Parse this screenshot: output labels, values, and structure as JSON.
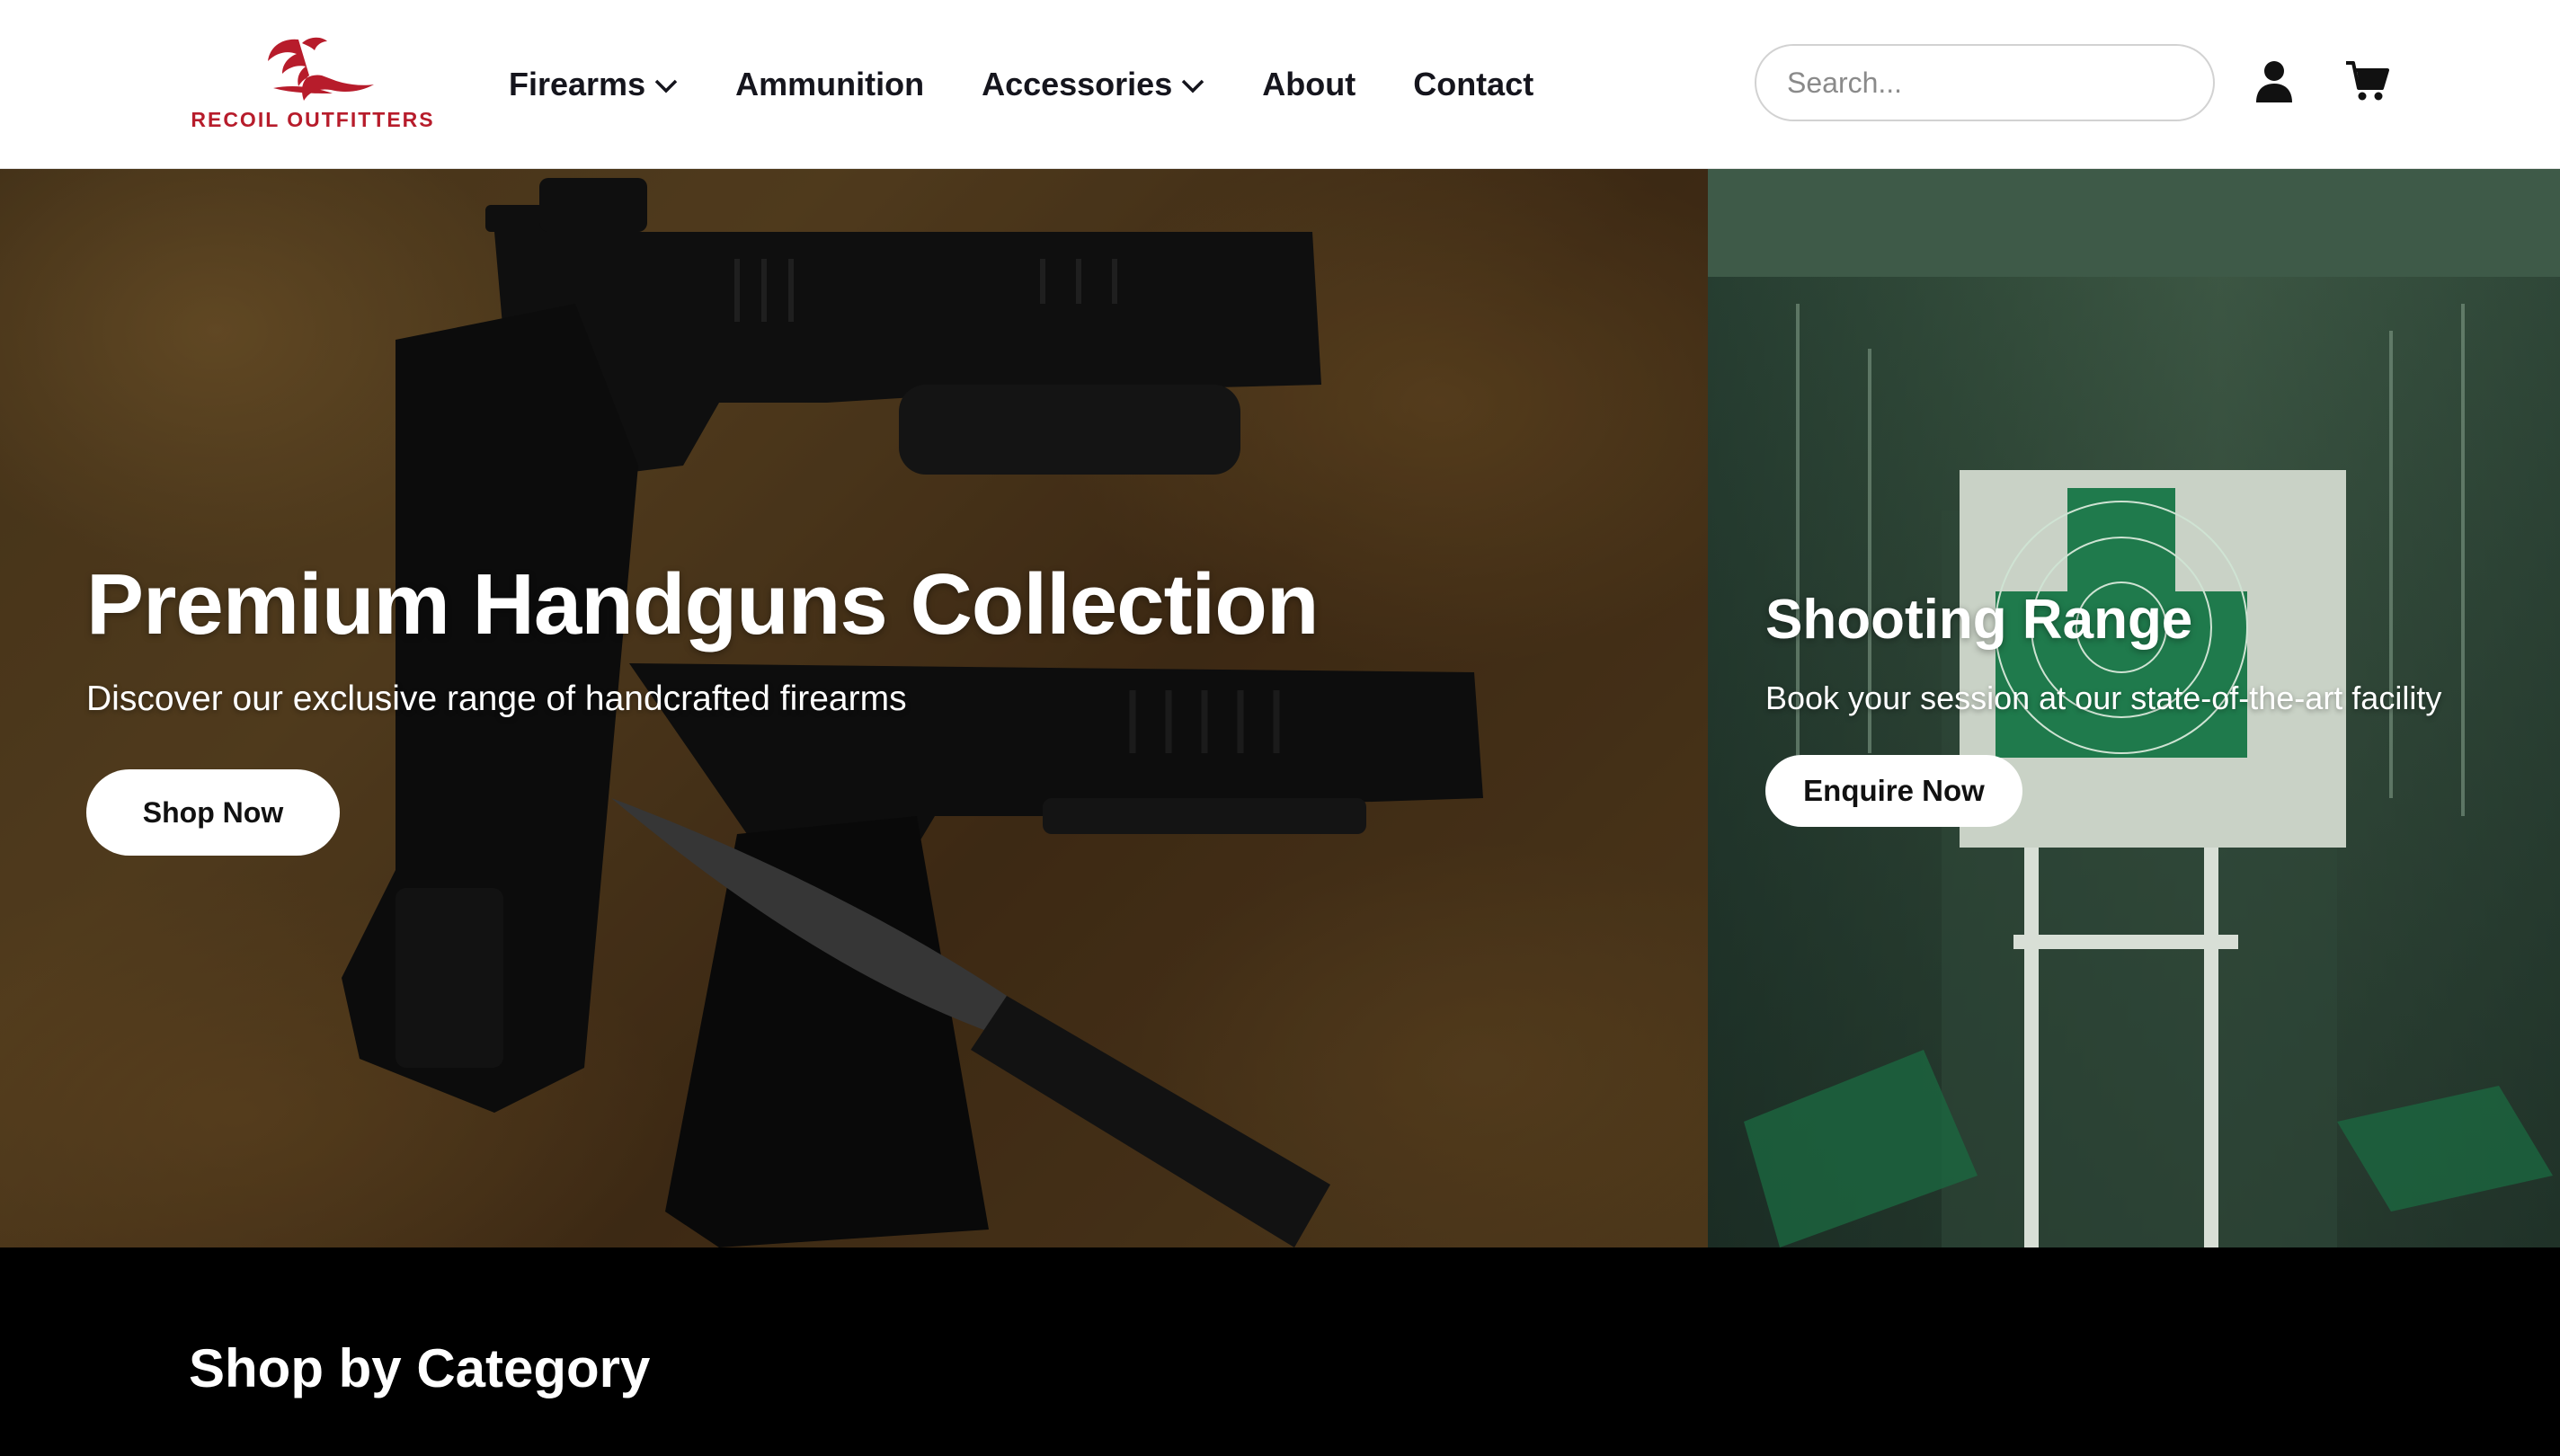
{
  "brand": {
    "name": "RECOIL OUTFITTERS",
    "accent_color": "#b71c2b",
    "logo_icon": "eagle-icon"
  },
  "nav": {
    "items": [
      {
        "label": "Firearms",
        "dropdown": true
      },
      {
        "label": "Ammunition",
        "dropdown": false
      },
      {
        "label": "Accessories",
        "dropdown": true
      },
      {
        "label": "About",
        "dropdown": false
      },
      {
        "label": "Contact",
        "dropdown": false
      }
    ]
  },
  "search": {
    "placeholder": "Search...",
    "value": ""
  },
  "header_icons": {
    "account": "user-icon",
    "cart": "cart-icon"
  },
  "hero": {
    "primary": {
      "title": "Premium Handguns Collection",
      "subtitle": "Discover our exclusive range of handcrafted firearms",
      "button": "Shop Now"
    },
    "secondary": {
      "title": "Shooting Range",
      "subtitle": "Book your session at our state-of-the-art facility",
      "button": "Enquire Now"
    }
  },
  "category_section": {
    "title": "Shop by Category"
  }
}
